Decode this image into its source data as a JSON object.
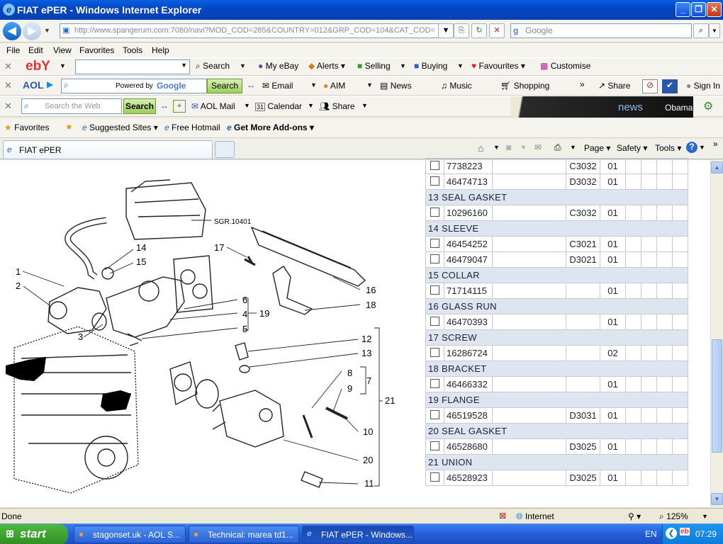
{
  "window": {
    "title": "FIAT ePER - Windows Internet Explorer"
  },
  "address_bar": {
    "url": "http://www.spangerum.com:7080/navi?MOD_COD=285&COUNTRY=012&GRP_COD=104&CAT_COD=",
    "search_placeholder": "Google"
  },
  "menu": [
    "File",
    "Edit",
    "View",
    "Favorites",
    "Tools",
    "Help"
  ],
  "ebay_toolbar": {
    "logo": "ebY",
    "search": "Search",
    "my_ebay": "My eBay",
    "alerts": "Alerts",
    "selling": "Selling",
    "buying": "Buying",
    "favourites": "Favourites",
    "customise": "Customise"
  },
  "aol_toolbar": {
    "logo": "AOL",
    "powered_by": "Powered by",
    "google": "Google",
    "search": "Search",
    "email": "Email",
    "aim": "AIM",
    "news": "News",
    "music": "Music",
    "shopping": "Shopping",
    "share": "Share",
    "sign_in": "Sign In"
  },
  "web_toolbar": {
    "placeholder": "Search the Web",
    "search": "Search",
    "aol_mail": "AOL Mail",
    "calendar": "Calendar",
    "calendar_day": "31",
    "share": "Share",
    "news_banner": "news",
    "news_text": "Obama"
  },
  "favorites_bar": {
    "favorites": "Favorites",
    "suggested": "Suggested Sites",
    "hotmail": "Free Hotmail",
    "addons": "Get More Add-ons"
  },
  "tab": {
    "title": "FIAT ePER"
  },
  "command_bar": {
    "page": "Page",
    "safety": "Safety",
    "tools": "Tools"
  },
  "diagram": {
    "ref": "SGR.10401",
    "callouts": [
      "1",
      "2",
      "3",
      "4",
      "5",
      "6",
      "7",
      "8",
      "9",
      "10",
      "11",
      "12",
      "13",
      "14",
      "15",
      "16",
      "17",
      "18",
      "19",
      "20",
      "21"
    ]
  },
  "parts": [
    {
      "type": "part",
      "part_no": "7738223",
      "code": "C3032",
      "qty": "01"
    },
    {
      "type": "part",
      "part_no": "46474713",
      "code": "D3032",
      "qty": "01"
    },
    {
      "type": "header",
      "label": "13 SEAL GASKET"
    },
    {
      "type": "part",
      "part_no": "10296160",
      "code": "C3032",
      "qty": "01"
    },
    {
      "type": "header",
      "label": "14 SLEEVE"
    },
    {
      "type": "part",
      "part_no": "46454252",
      "code": "C3021",
      "qty": "01"
    },
    {
      "type": "part",
      "part_no": "46479047",
      "code": "D3021",
      "qty": "01"
    },
    {
      "type": "header",
      "label": "15 COLLAR"
    },
    {
      "type": "part",
      "part_no": "71714115",
      "code": "",
      "qty": "01"
    },
    {
      "type": "header",
      "label": "16 GLASS RUN"
    },
    {
      "type": "part",
      "part_no": "46470393",
      "code": "",
      "qty": "01"
    },
    {
      "type": "header",
      "label": "17 SCREW"
    },
    {
      "type": "part",
      "part_no": "16286724",
      "code": "",
      "qty": "02"
    },
    {
      "type": "header",
      "label": "18 BRACKET"
    },
    {
      "type": "part",
      "part_no": "46466332",
      "code": "",
      "qty": "01"
    },
    {
      "type": "header",
      "label": "19 FLANGE"
    },
    {
      "type": "part",
      "part_no": "46519528",
      "code": "D3031",
      "qty": "01"
    },
    {
      "type": "header",
      "label": "20 SEAL GASKET"
    },
    {
      "type": "part",
      "part_no": "46528680",
      "code": "D3025",
      "qty": "01"
    },
    {
      "type": "header",
      "label": "21 UNION"
    },
    {
      "type": "part",
      "part_no": "46528923",
      "code": "D3025",
      "qty": "01"
    }
  ],
  "status": {
    "text": "Done",
    "zone": "Internet",
    "zoom": "125%"
  },
  "taskbar": {
    "start": "start",
    "tasks": [
      "stagonset.uk - AOL S...",
      "Technical: marea td1...",
      "FIAT ePER - Windows..."
    ],
    "lang": "EN",
    "clock": "07:29"
  },
  "colors": {
    "title_blue": "#0047c6",
    "taskbar_blue": "#245edb",
    "start_green": "#3c9a2d",
    "row_header": "#dde5f0"
  }
}
